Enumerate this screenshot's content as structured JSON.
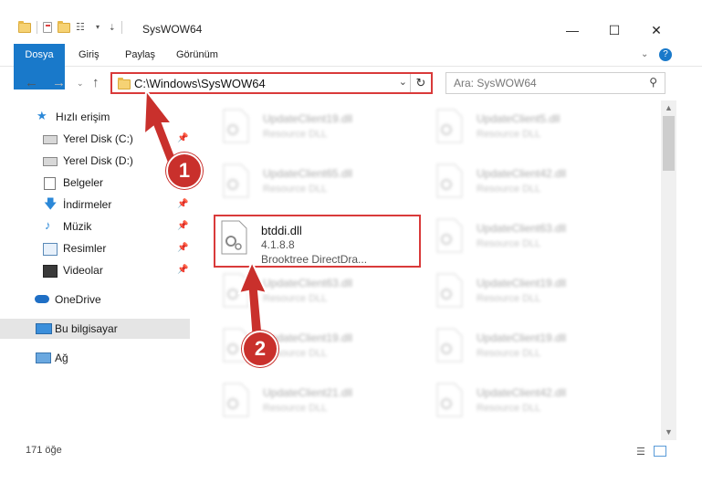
{
  "window": {
    "title": "SysWOW64"
  },
  "menu": {
    "file": "Dosya",
    "home": "Giriş",
    "share": "Paylaş",
    "view": "Görünüm"
  },
  "address": {
    "path": "C:\\Windows\\SysWOW64"
  },
  "search": {
    "placeholder": "Ara: SysWOW64"
  },
  "nav": {
    "quick_access": "Hızlı erişim",
    "items": [
      "Yerel Disk (C:)",
      "Yerel Disk (D:)",
      "Belgeler",
      "İndirmeler",
      "Müzik",
      "Resimler",
      "Videolar"
    ],
    "onedrive": "OneDrive",
    "this_pc": "Bu bilgisayar",
    "network": "Ağ"
  },
  "files_left": [
    {
      "name": "UpdateClient19.dll",
      "desc": "Resource DLL"
    },
    {
      "name": "UpdateClient65.dll",
      "desc": "Resource DLL"
    },
    {
      "name": "UpdateClient63.dll",
      "desc": "Resource DLL"
    },
    {
      "name": "UpdateClient19.dll",
      "desc": "Resource DLL"
    },
    {
      "name": "UpdateClient21.dll",
      "desc": "Resource DLL"
    }
  ],
  "files_right": [
    {
      "name": "UpdateClient5.dll",
      "desc": "Resource DLL"
    },
    {
      "name": "UpdateClient42.dll",
      "desc": "Resource DLL"
    },
    {
      "name": "UpdateClient63.dll",
      "desc": "Resource DLL"
    },
    {
      "name": "UpdateClient19.dll",
      "desc": "Resource DLL"
    },
    {
      "name": "UpdateClient19.dll",
      "desc": "Resource DLL"
    },
    {
      "name": "UpdateClient42.dll",
      "desc": "Resource DLL"
    }
  ],
  "highlight_file": {
    "name": "btddi.dll",
    "version": "4.1.8.8",
    "desc": "Brooktree DirectDra..."
  },
  "status": {
    "count": "171 öğe"
  },
  "callouts": [
    "1",
    "2"
  ],
  "colors": {
    "accent": "#1979ca",
    "callout": "#c9302c",
    "highlight": "#d93a3a"
  }
}
